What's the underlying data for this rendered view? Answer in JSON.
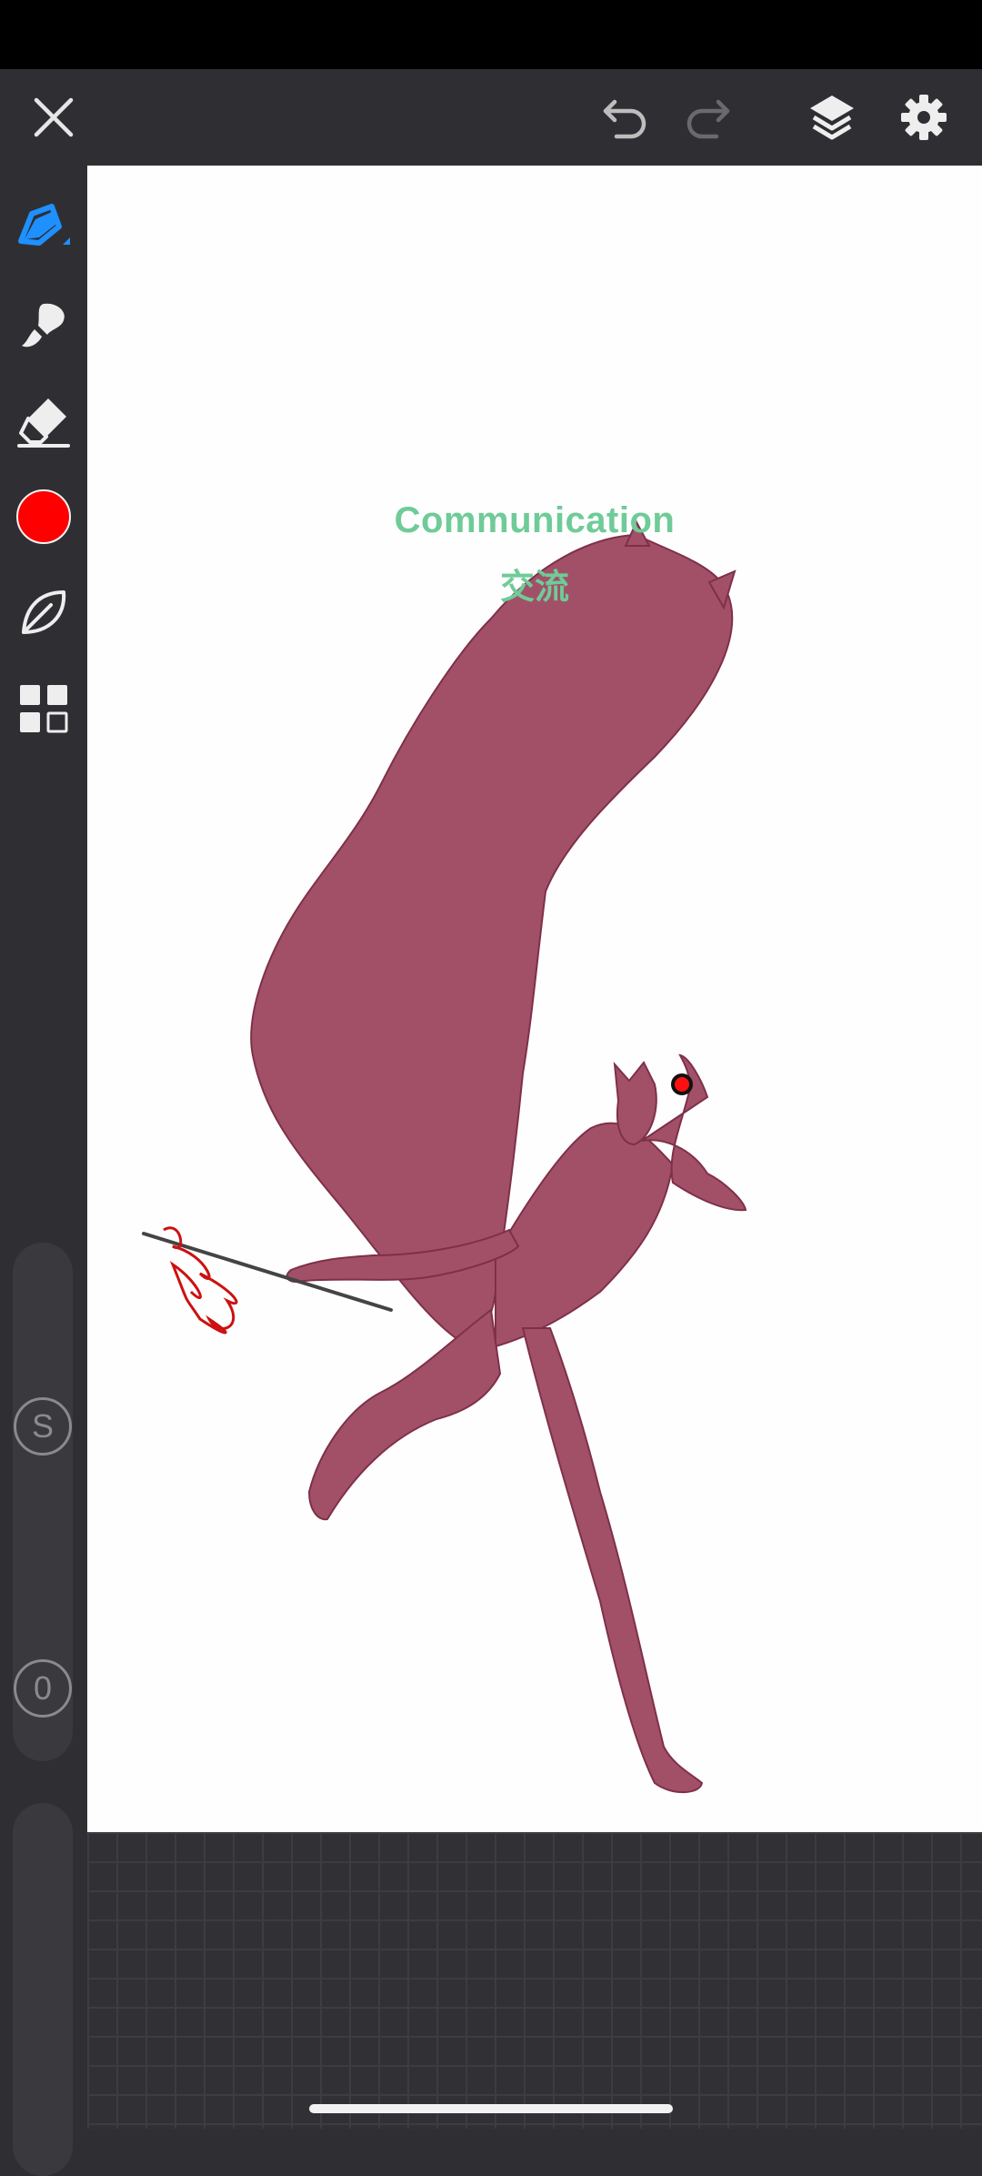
{
  "canvas": {
    "title": "Communication",
    "subtitle": "交流",
    "figure_color": "#a25068",
    "background": "#fefefe"
  },
  "toolbar": {
    "close_icon": "close-icon",
    "undo_icon": "undo-icon",
    "redo_icon": "redo-icon",
    "layers_icon": "layers-icon",
    "settings_icon": "gear-icon"
  },
  "sidebar": {
    "tools": [
      "pen-icon",
      "smudge-icon",
      "eraser-icon",
      "color-swatch",
      "leaf-icon",
      "grid-icon"
    ],
    "active_color": "#ff0000",
    "active_tool_color": "#1e90ff",
    "size_slider_label": "S",
    "opacity_slider_label": "0"
  }
}
